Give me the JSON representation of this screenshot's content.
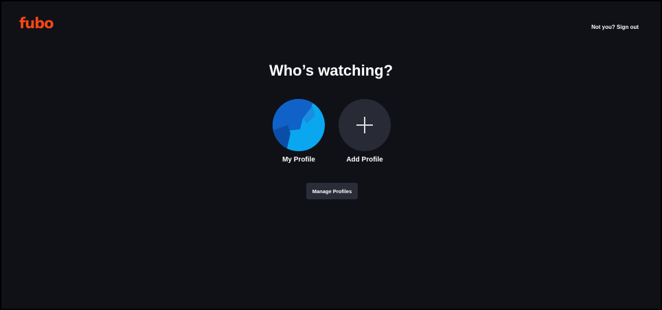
{
  "header": {
    "logo_text": "fubo",
    "signout_label": "Not you? Sign out"
  },
  "main": {
    "title": "Who’s watching?",
    "profiles": [
      {
        "label": "My Profile",
        "icon": "profile-avatar"
      },
      {
        "label": "Add Profile",
        "icon": "plus-icon"
      }
    ],
    "manage_label": "Manage Profiles"
  },
  "colors": {
    "background": "#0f1117",
    "brand": "#fa4616",
    "avatar_blue_light": "#0aa7f0",
    "avatar_blue_dark": "#1062c8",
    "button_bg": "#2a2d37"
  }
}
